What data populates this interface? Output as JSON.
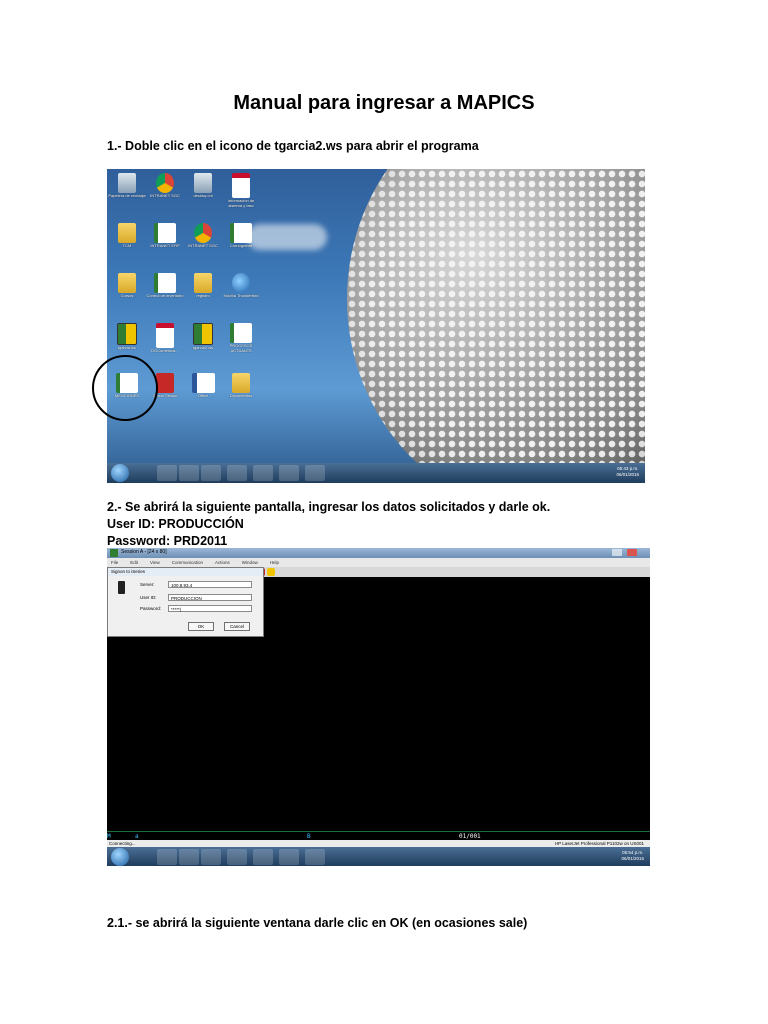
{
  "document": {
    "title": "Manual para ingresar a MAPICS",
    "step1": {
      "prefix": "1.- Doble clic en el icono de ",
      "bold": "tgarcia2.ws",
      "suffix": " para abrir el programa"
    },
    "step2": {
      "line1": "2.-   Se abrirá la siguiente pantalla, ingresar los datos solicitados y darle ok.",
      "line2": "User ID: PRODUCCIÓN",
      "line3": "Password: PRD2011"
    },
    "step21": {
      "prefix": "2.1.- se abrirá la siguiente ventana darle clic en ",
      "bold": "OK",
      "suffix": " (en ocasiones sale)"
    }
  },
  "screenshot1": {
    "icons": [
      {
        "name": "recycle-bin-icon",
        "kind": "bin",
        "label": "Papelera de reciclaje"
      },
      {
        "name": "chrome-icon",
        "kind": "chrome",
        "label": "INTRANET SGC"
      },
      {
        "name": "desktop-icon",
        "kind": "bin",
        "label": "desktop.ini"
      },
      {
        "name": "pdf-icon",
        "kind": "pdf",
        "label": "Informacion de sistema y fasc"
      },
      {
        "name": "folder-icon",
        "kind": "folder",
        "label": "TCM"
      },
      {
        "name": "intranet-icon",
        "kind": "doc",
        "label": "INTRANET ERP"
      },
      {
        "name": "chrome-icon",
        "kind": "chrome",
        "label": "INTRANET SGC"
      },
      {
        "name": "excel-icon",
        "kind": "doc",
        "label": "Cronograma"
      },
      {
        "name": "folder-icon",
        "kind": "folder",
        "label": "Cursos"
      },
      {
        "name": "doc-icon",
        "kind": "doc",
        "label": "Control de inventario"
      },
      {
        "name": "folder-icon",
        "kind": "folder",
        "label": "registro"
      },
      {
        "name": "thunderbird-icon",
        "kind": "globe",
        "label": "Mozilla Thunderbird"
      },
      {
        "name": "app-icon",
        "kind": "app",
        "label": "tgarcia.ws"
      },
      {
        "name": "pdf-icon",
        "kind": "pdf",
        "label": "DOCumentos..."
      },
      {
        "name": "tgarcia2-icon",
        "kind": "app",
        "label": "tgarcia2.ws"
      },
      {
        "name": "doc-icon",
        "kind": "doc",
        "label": "PROCESOS ACTUALES"
      },
      {
        "name": "doc-icon",
        "kind": "doc",
        "label": "MENCIONES"
      },
      {
        "name": "red-app-icon",
        "kind": "red",
        "label": "Cerrar Sesion"
      },
      {
        "name": "word-icon",
        "kind": "word",
        "label": "Office"
      },
      {
        "name": "folder-icon",
        "kind": "folder",
        "label": "Documentos"
      }
    ],
    "clock": {
      "time": "05:43 p.m.",
      "date": "06/01/2016"
    }
  },
  "screenshot2": {
    "window_title": "Session A - [24 x 80]",
    "menu": [
      "File",
      "Edit",
      "View",
      "Communication",
      "Actions",
      "Window",
      "Help"
    ],
    "dialog": {
      "title": "Signon to iSeries",
      "server_label": "Server:",
      "server_value": "100.8.93.4",
      "userid_label": "User ID:",
      "userid_value": "PRODUCCION",
      "password_label": "Password:",
      "password_value": "*****|",
      "ok": "OK",
      "cancel": "Cancel"
    },
    "status": {
      "a": "M",
      "b": "a",
      "c": "B",
      "d": "01/001"
    },
    "connecting": "Connecting...",
    "printer": "HP LaserJet Professional P1102w on US001",
    "clock": {
      "time": "05:54 p.m.",
      "date": "06/01/2016"
    }
  },
  "colors": {
    "desktop_blue": "#3d79b8",
    "terminal_bg": "#000000",
    "status_cyan": "#39c6ff"
  }
}
